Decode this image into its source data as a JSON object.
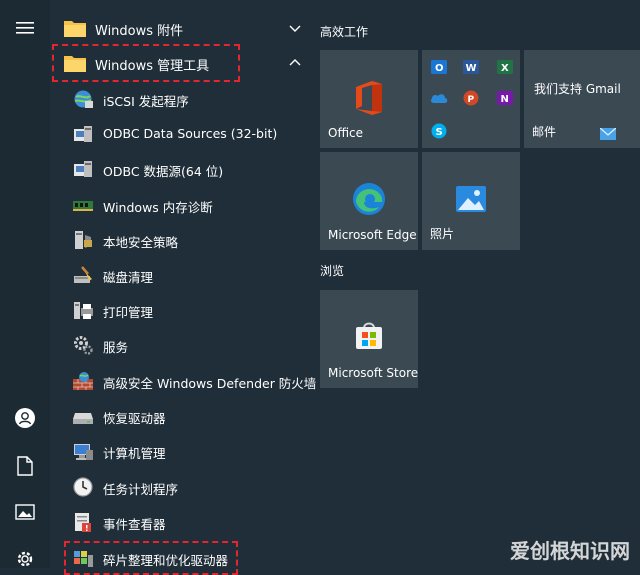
{
  "start_menu": {
    "list": {
      "folders": [
        {
          "label": "Windows 附件",
          "expanded": false
        },
        {
          "label": "Windows 管理工具",
          "expanded": true
        }
      ],
      "apps": [
        {
          "label": "iSCSI 发起程序",
          "icon": "iscsi-globe-icon"
        },
        {
          "label": "ODBC Data Sources (32-bit)",
          "icon": "odbc-icon"
        },
        {
          "label": "ODBC 数据源(64 位)",
          "icon": "odbc-icon"
        },
        {
          "label": "Windows 内存诊断",
          "icon": "memory-diagnostic-icon"
        },
        {
          "label": "本地安全策略",
          "icon": "security-policy-icon"
        },
        {
          "label": "磁盘清理",
          "icon": "disk-cleanup-icon"
        },
        {
          "label": "打印管理",
          "icon": "print-management-icon"
        },
        {
          "label": "服务",
          "icon": "services-gear-icon"
        },
        {
          "label": "高级安全 Windows Defender 防火墙",
          "icon": "firewall-icon"
        },
        {
          "label": "恢复驱动器",
          "icon": "recovery-drive-icon"
        },
        {
          "label": "计算机管理",
          "icon": "computer-management-icon"
        },
        {
          "label": "任务计划程序",
          "icon": "task-scheduler-icon"
        },
        {
          "label": "事件查看器",
          "icon": "event-viewer-icon"
        },
        {
          "label": "碎片整理和优化驱动器",
          "icon": "defragment-icon"
        }
      ]
    },
    "groups": {
      "productivity": "高效工作",
      "browse": "浏览"
    },
    "tiles": {
      "office": "Office",
      "gmail_title": "我们支持 Gmail",
      "mail": "邮件",
      "edge": "Microsoft Edge",
      "photos": "照片",
      "store": "Microsoft Store"
    },
    "watermark": "爱创根知识网",
    "colors": {
      "background": "#1f2e38",
      "tile": "#3b4953",
      "highlight_dashes": "#e6262e"
    }
  }
}
